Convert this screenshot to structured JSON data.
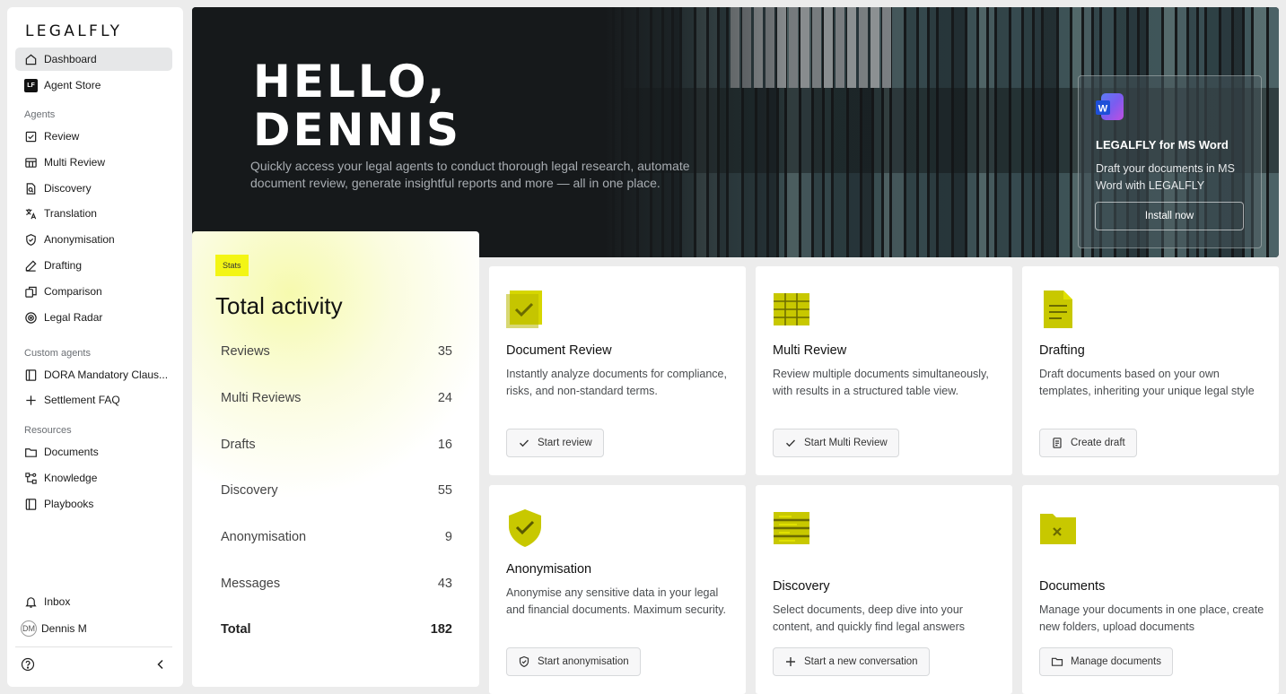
{
  "sidebar": {
    "logo": "LEGALFLY",
    "top_items": [
      {
        "label": "Dashboard",
        "icon": "home-icon"
      },
      {
        "label": "Agent Store",
        "icon": "lf-badge-icon",
        "badge": "LF"
      }
    ],
    "agents_label": "Agents",
    "agents": [
      {
        "label": "Review",
        "icon": "review-check-icon"
      },
      {
        "label": "Multi Review",
        "icon": "table-icon"
      },
      {
        "label": "Discovery",
        "icon": "document-search-icon"
      },
      {
        "label": "Translation",
        "icon": "translate-icon"
      },
      {
        "label": "Anonymisation",
        "icon": "shield-check-icon"
      },
      {
        "label": "Drafting",
        "icon": "pencil-icon"
      },
      {
        "label": "Comparison",
        "icon": "compare-icon"
      },
      {
        "label": "Legal Radar",
        "icon": "radar-icon"
      }
    ],
    "custom_label": "Custom agents",
    "custom": [
      {
        "label": "DORA Mandatory Claus...",
        "icon": "book-icon"
      },
      {
        "label": "Settlement FAQ",
        "icon": "plus-icon"
      }
    ],
    "resources_label": "Resources",
    "resources": [
      {
        "label": "Documents",
        "icon": "folder-icon"
      },
      {
        "label": "Knowledge",
        "icon": "knowledge-icon"
      },
      {
        "label": "Playbooks",
        "icon": "book-icon"
      }
    ],
    "inbox": "Inbox",
    "user": {
      "initials": "DM",
      "name": "Dennis M"
    }
  },
  "hero": {
    "title_line1": "HELLO,",
    "title_line2": "DENNIS",
    "subtitle": "Quickly access your legal agents to conduct thorough legal research, automate document review, generate insightful reports and more — all in one place.",
    "word_card": {
      "title": "LEGALFLY for MS Word",
      "desc": "Draft your documents in MS Word with LEGALFLY",
      "button": "Install now",
      "icon_letter": "W"
    }
  },
  "stats": {
    "badge": "Stats",
    "title": "Total activity",
    "rows": [
      {
        "label": "Reviews",
        "value": "35"
      },
      {
        "label": "Multi Reviews",
        "value": "24"
      },
      {
        "label": "Drafts",
        "value": "16"
      },
      {
        "label": "Discovery",
        "value": "55"
      },
      {
        "label": "Anonymisation",
        "value": "9"
      },
      {
        "label": "Messages",
        "value": "43"
      }
    ],
    "total": {
      "label": "Total",
      "value": "182"
    }
  },
  "cards": [
    {
      "title": "Document Review",
      "desc": "Instantly analyze documents for compliance, risks, and non-standard terms.",
      "button": "Start review",
      "button_icon": "check-icon",
      "icon": "document-review-icon"
    },
    {
      "title": "Multi Review",
      "desc": "Review multiple documents simultaneously, with results in a structured table view.",
      "button": "Start Multi Review",
      "button_icon": "check-icon",
      "icon": "multi-review-icon"
    },
    {
      "title": "Drafting",
      "desc": "Draft documents based on your own templates, inheriting your unique legal style",
      "button": "Create draft",
      "button_icon": "document-icon",
      "icon": "drafting-icon"
    },
    {
      "title": "Anonymisation",
      "desc": "Anonymise any sensitive data in your legal and financial documents. Maximum security.",
      "button": "Start anonymisation",
      "button_icon": "shield-icon",
      "icon": "anonymisation-icon"
    },
    {
      "title": "Discovery",
      "desc": "Select documents, deep dive into your content, and quickly find legal answers",
      "button": "Start a new conversation",
      "button_icon": "plus-icon",
      "icon": "discovery-icon"
    },
    {
      "title": "Documents",
      "desc": "Manage your documents in one place, create new folders, upload documents",
      "button": "Manage documents",
      "button_icon": "folder-icon",
      "icon": "documents-icon"
    }
  ],
  "colors": {
    "accent_yellow": "#f3f515",
    "icon_yellow": "#c8c800",
    "hero_bg": "#16191b"
  }
}
